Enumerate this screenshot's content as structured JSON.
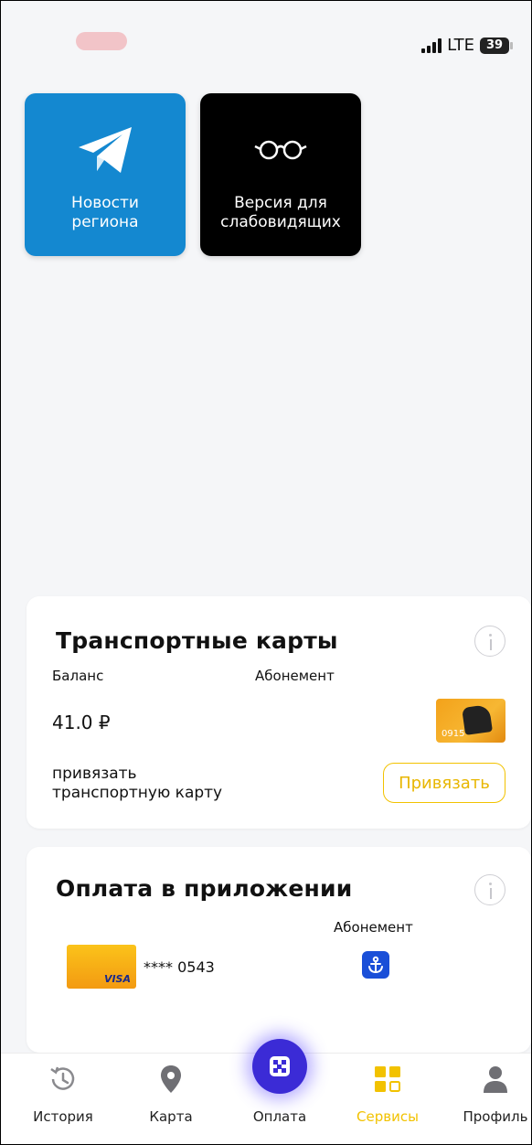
{
  "status_bar": {
    "network": "LTE",
    "battery": "39"
  },
  "tiles": [
    {
      "label": "Новости\nрегиона",
      "color": "#1488d0",
      "icon": "telegram-plane-icon"
    },
    {
      "label": "Версия для\nслабовидящих",
      "color": "#000000",
      "icon": "glasses-icon"
    }
  ],
  "transport_cards": {
    "title": "Транспортные карты",
    "balance_label": "Баланс",
    "subscription_label": "Абонемент",
    "balance_value": "41.0 ₽",
    "card_number": "0915",
    "link_text": "привязать\nтранспортную карту",
    "bind_button": "Привязать"
  },
  "in_app_payment": {
    "title": "Оплата в приложении",
    "subscription_label": "Абонемент",
    "card_brand": "VISA",
    "card_masked": "**** 0543",
    "subscription_icon": "anchor-icon"
  },
  "bottom_nav": {
    "items": [
      {
        "label": "История",
        "icon": "history-icon"
      },
      {
        "label": "Карта",
        "icon": "map-pin-icon"
      },
      {
        "label": "Оплата",
        "icon": "qr-icon"
      },
      {
        "label": "Сервисы",
        "icon": "grid-icon",
        "active": true
      },
      {
        "label": "Профиль",
        "icon": "user-icon"
      }
    ]
  },
  "colors": {
    "accent": "#f2c200",
    "primary": "#3b2bd6",
    "news_blue": "#1488d0"
  }
}
